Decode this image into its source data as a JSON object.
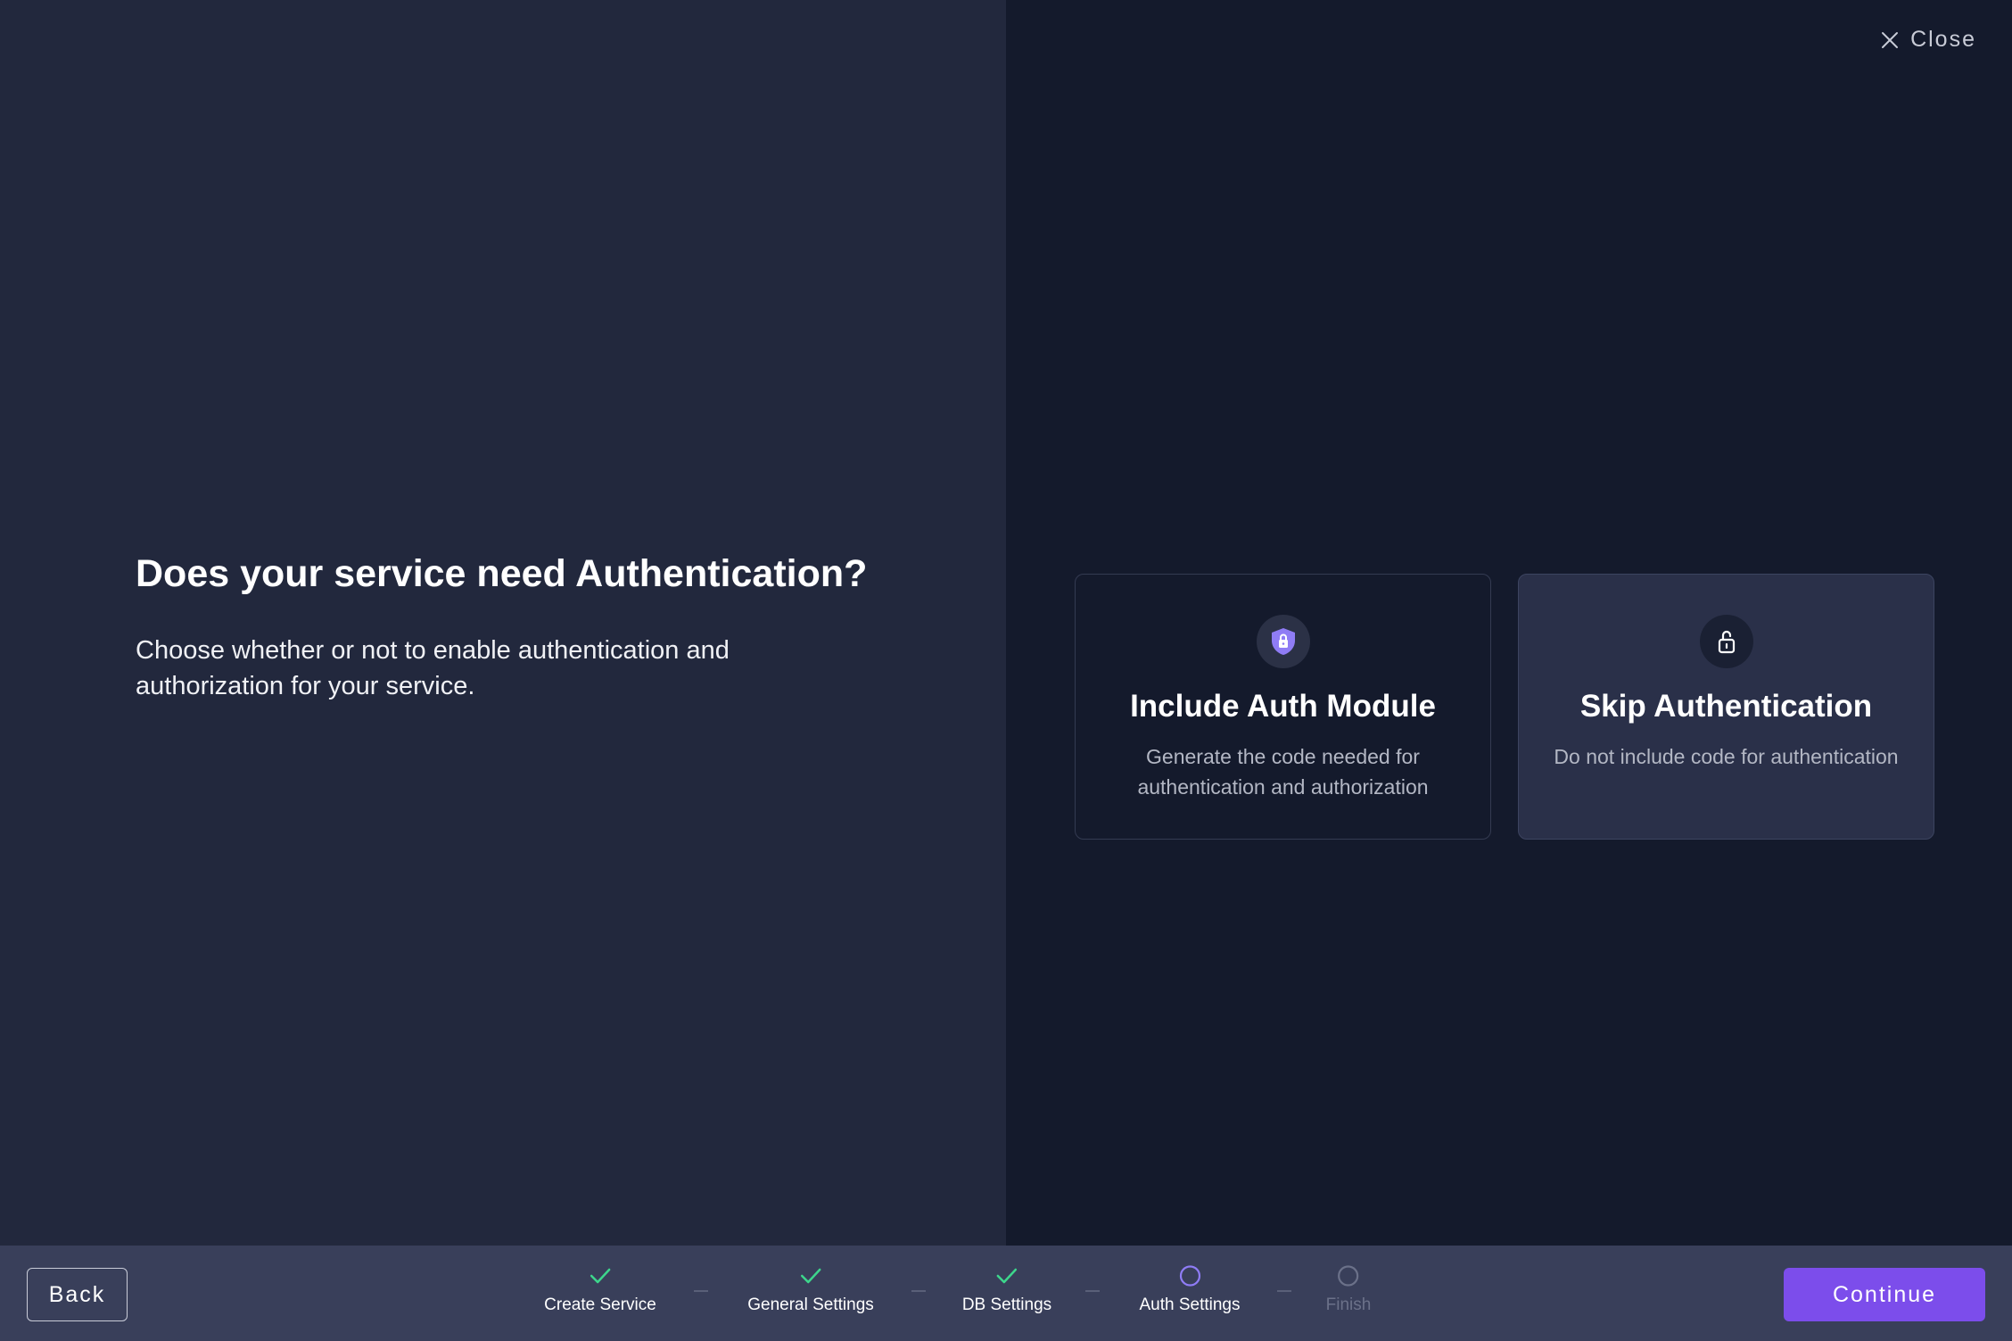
{
  "header": {
    "close_label": "Close"
  },
  "main": {
    "title": "Does your service need Authentication?",
    "description": "Choose whether or not to enable authentication and authorization for your service."
  },
  "options": [
    {
      "title": "Include Auth Module",
      "description": "Generate the code needed for authentication and authorization",
      "icon": "shield-lock-icon"
    },
    {
      "title": "Skip Authentication",
      "description": "Do not include code for authentication",
      "icon": "unlock-icon"
    }
  ],
  "footer": {
    "back_label": "Back",
    "continue_label": "Continue",
    "steps": [
      {
        "label": "Create Service",
        "status": "complete"
      },
      {
        "label": "General Settings",
        "status": "complete"
      },
      {
        "label": "DB Settings",
        "status": "complete"
      },
      {
        "label": "Auth Settings",
        "status": "current"
      },
      {
        "label": "Finish",
        "status": "pending"
      }
    ]
  },
  "colors": {
    "accent": "#7c4deb",
    "complete": "#3dd68c",
    "current": "#8f7cf5",
    "pending": "#6b7189"
  }
}
